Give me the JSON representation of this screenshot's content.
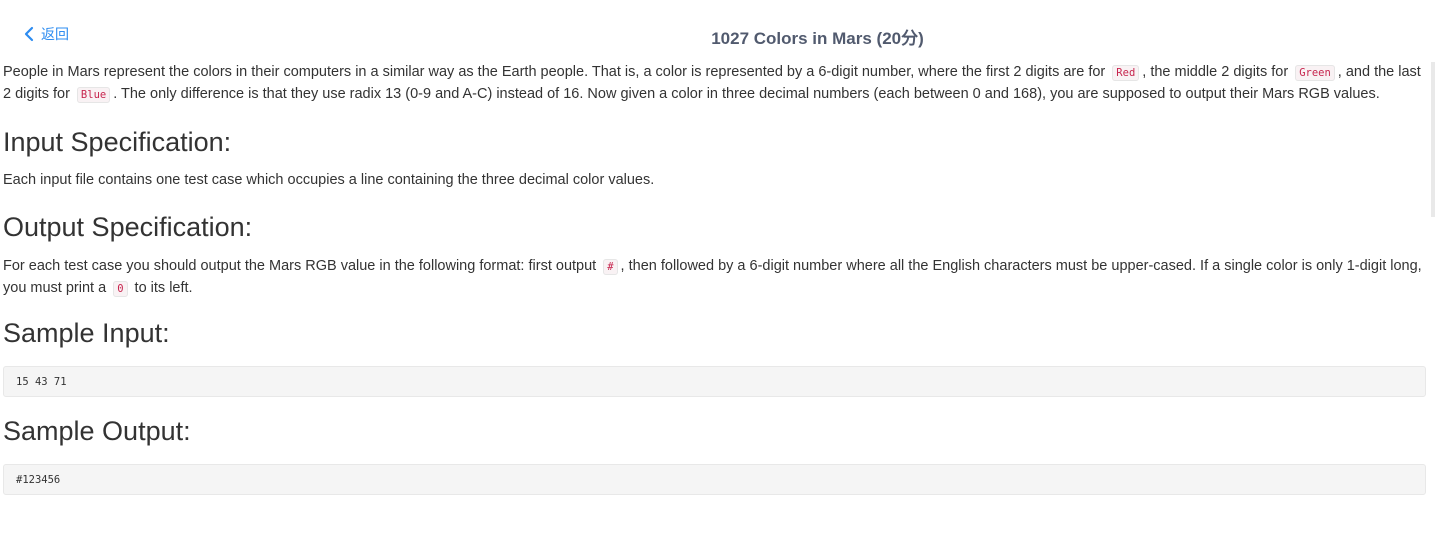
{
  "header": {
    "back_label": "返回",
    "title": "1027 Colors in Mars (20分)"
  },
  "problem": {
    "description": {
      "part1": "People in Mars represent the colors in their computers in a similar way as the Earth people. That is, a color is represented by a 6-digit number, where the first 2 digits are for ",
      "code_red": "Red",
      "part2": ", the middle 2 digits for ",
      "code_green": "Green",
      "part3": ", and the last 2 digits for ",
      "code_blue": "Blue",
      "part4": ". The only difference is that they use radix 13 (0-9 and A-C) instead of 16. Now given a color in three decimal numbers (each between 0 and 168), you are supposed to output their Mars RGB values."
    },
    "input_spec": {
      "heading": "Input Specification:",
      "text": "Each input file contains one test case which occupies a line containing the three decimal color values."
    },
    "output_spec": {
      "heading": "Output Specification:",
      "part1": "For each test case you should output the Mars RGB value in the following format: first output ",
      "code_hash": "#",
      "part2": ", then followed by a 6-digit number where all the English characters must be upper-cased. If a single color is only 1-digit long, you must print a ",
      "code_zero": "0",
      "part3": " to its left."
    },
    "sample_input": {
      "heading": "Sample Input:",
      "code": "15 43 71"
    },
    "sample_output": {
      "heading": "Sample Output:",
      "code": "#123456"
    }
  },
  "colors": {
    "link": "#2d8cf0",
    "code_text": "#c7254e",
    "code_bg": "#f9f2f4",
    "pre_bg": "#f5f5f5"
  },
  "icons": {
    "back": "chevron-left-icon"
  }
}
